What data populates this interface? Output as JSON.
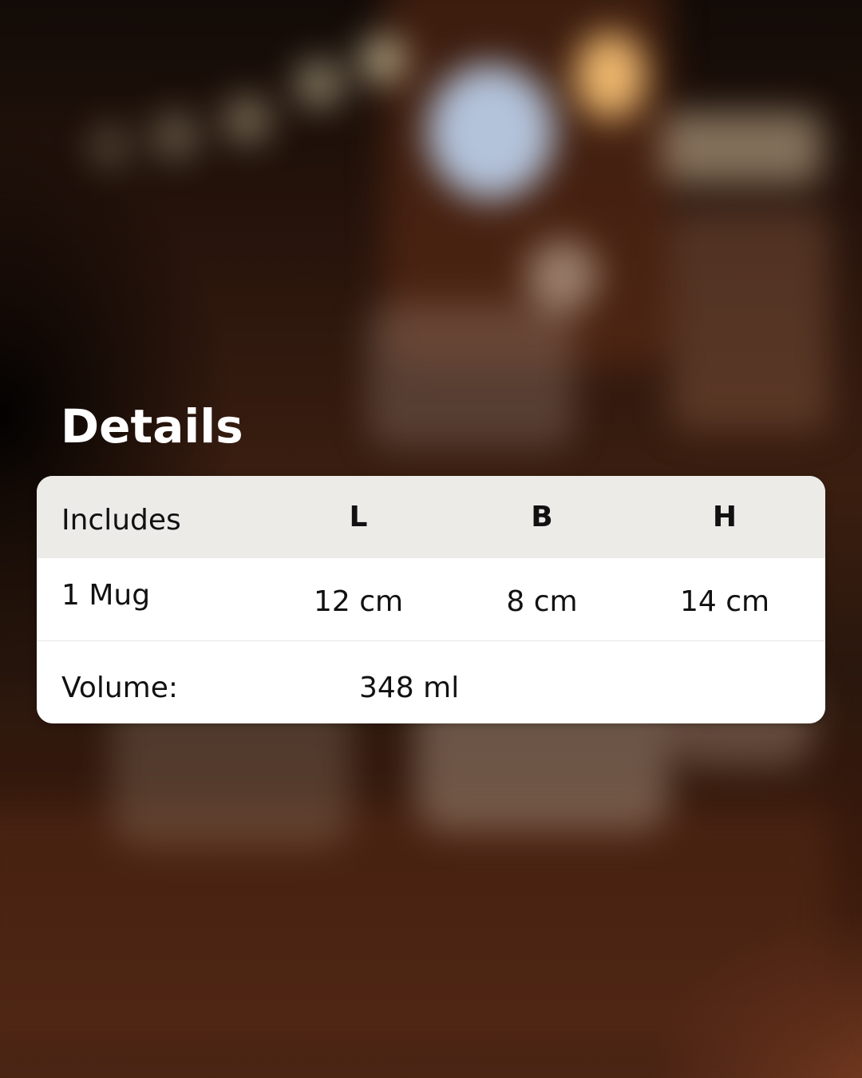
{
  "title": "Details",
  "table": {
    "headers": [
      "Includes",
      "L",
      "B",
      "H"
    ],
    "rows": [
      [
        "1 Mug",
        "12 cm",
        "8 cm",
        "14 cm"
      ]
    ],
    "volume": {
      "label": "Volume:",
      "value": "348 ml"
    }
  },
  "colors": {
    "header_background": "#ecebe8",
    "card_background": "#ffffff",
    "title_color": "#ffffff",
    "text_color": "#111111"
  }
}
